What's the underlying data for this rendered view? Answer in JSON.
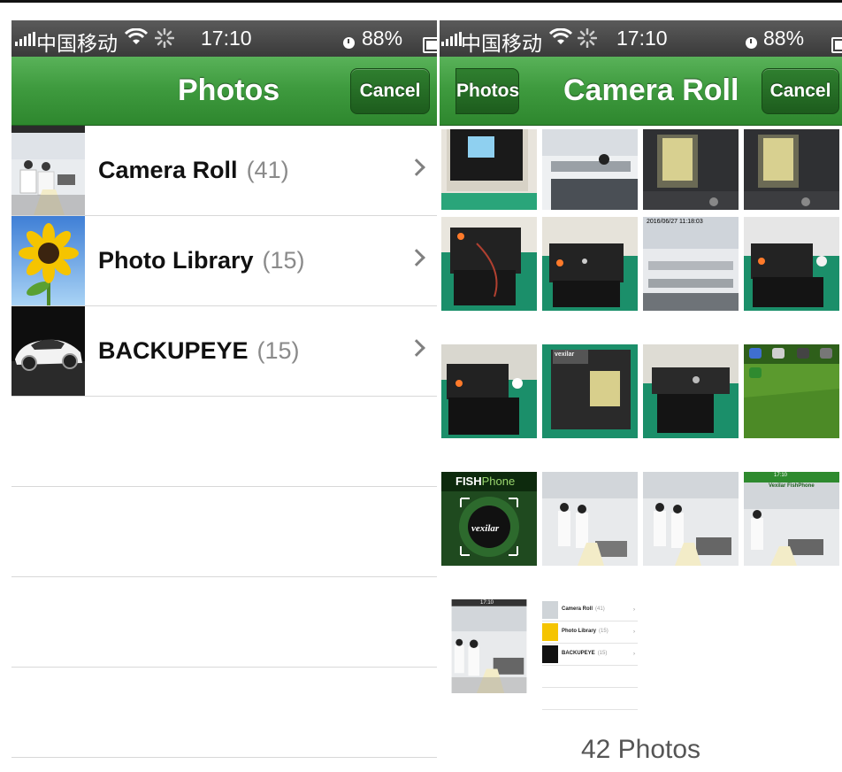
{
  "status_left": {
    "carrier": "中国移动",
    "time": "17:10",
    "battery": "88%"
  },
  "status_right": {
    "carrier": "中国移动",
    "time": "17:10",
    "battery": "88%"
  },
  "left_screen": {
    "nav_title": "Photos",
    "cancel_label": "Cancel",
    "albums": [
      {
        "name": "Camera Roll",
        "count": "(41)"
      },
      {
        "name": "Photo Library",
        "count": "(15)"
      },
      {
        "name": "BACKUPEYE",
        "count": "(15)"
      }
    ]
  },
  "right_screen": {
    "back_label": "Photos",
    "nav_title": "Camera Roll",
    "cancel_label": "Cancel",
    "footer": "42 Photos",
    "thumb_texts": {
      "timestamp": "2016/06/27 11:18:03",
      "fishphone_brand": "FISH",
      "fishphone_brand2": "Phone",
      "vexilar": "vexilar",
      "vexilar_bar": "Vexilar FishPhone",
      "mini_time": "17:10",
      "mini_status": "17:10",
      "mini_albums": [
        {
          "name": "Camera Roll",
          "count": "(41)"
        },
        {
          "name": "Photo Library",
          "count": "(15)"
        },
        {
          "name": "BACKUPEYE",
          "count": "(15)"
        }
      ]
    }
  },
  "colors": {
    "nav_green": "#3f9b3f",
    "status_gray": "#3a3a3a",
    "count_gray": "#8a8a8a"
  }
}
